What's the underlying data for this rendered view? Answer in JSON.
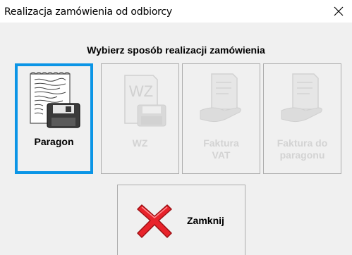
{
  "window": {
    "title": "Realizacja zamówienia od odbiorcy",
    "close_glyph": "✕"
  },
  "heading": "Wybierz sposób realizacji zamówienia",
  "options": [
    {
      "label": "Paragon",
      "icon": "receipt-floppy-icon",
      "state": "selected"
    },
    {
      "label": "WZ",
      "icon": "wz-document-icon",
      "state": "disabled"
    },
    {
      "label": "Faktura VAT",
      "icon": "hand-document-icon",
      "state": "disabled"
    },
    {
      "label": "Faktura do paragonu",
      "icon": "hand-document-icon",
      "state": "disabled"
    }
  ],
  "close_button": {
    "label": "Zamknij",
    "icon": "red-x-icon"
  },
  "colors": {
    "selection_border": "#0b95e6",
    "disabled_text": "#d3d3d3",
    "x_red": "#e8232b"
  }
}
